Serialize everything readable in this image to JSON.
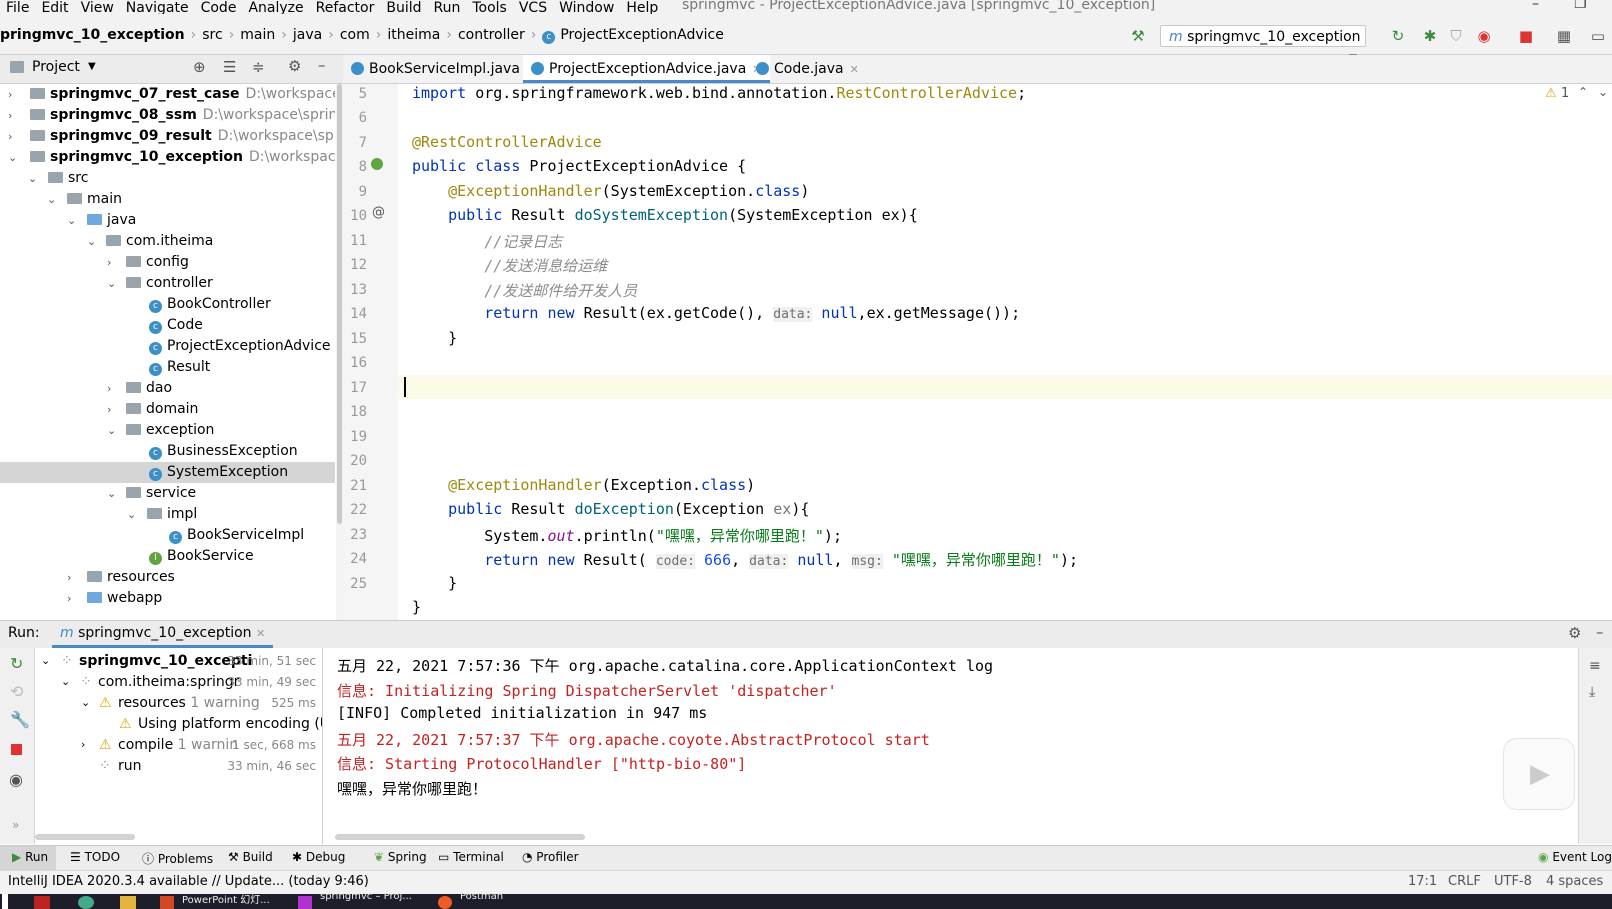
{
  "menubar": {
    "items": [
      "File",
      "Edit",
      "View",
      "Navigate",
      "Code",
      "Analyze",
      "Refactor",
      "Build",
      "Run",
      "Tools",
      "VCS",
      "Window",
      "Help"
    ],
    "window_title": "springmvc - ProjectExceptionAdvice.java [springmvc_10_exception]"
  },
  "breadcrumb": [
    "pringmvc_10_exception",
    "src",
    "main",
    "java",
    "com",
    "itheima",
    "controller",
    "ProjectExceptionAdvice"
  ],
  "run_config": "springmvc_10_exception",
  "project_panel": {
    "title": "Project"
  },
  "tree": [
    {
      "label": "springmvc_07_rest_case",
      "path": "D:\\workspace\\spri",
      "bold": true
    },
    {
      "label": "springmvc_08_ssm",
      "path": "D:\\workspace\\springmv",
      "bold": true
    },
    {
      "label": "springmvc_09_result",
      "path": "D:\\workspace\\springm",
      "bold": true
    },
    {
      "label": "springmvc_10_exception",
      "path": "D:\\workspace\\spr",
      "bold": true
    },
    {
      "label": "src"
    },
    {
      "label": "main"
    },
    {
      "label": "java"
    },
    {
      "label": "com.itheima"
    },
    {
      "label": "config"
    },
    {
      "label": "controller"
    },
    {
      "label": "BookController"
    },
    {
      "label": "Code"
    },
    {
      "label": "ProjectExceptionAdvice"
    },
    {
      "label": "Result"
    },
    {
      "label": "dao"
    },
    {
      "label": "domain"
    },
    {
      "label": "exception"
    },
    {
      "label": "BusinessException"
    },
    {
      "label": "SystemException"
    },
    {
      "label": "service"
    },
    {
      "label": "impl"
    },
    {
      "label": "BookServiceImpl"
    },
    {
      "label": "BookService"
    },
    {
      "label": "resources"
    },
    {
      "label": "webapp"
    }
  ],
  "tabs": [
    "BookServiceImpl.java",
    "ProjectExceptionAdvice.java",
    "Code.java"
  ],
  "editor": {
    "line_numbers": [
      "5",
      "6",
      "7",
      "8",
      "9",
      "10",
      "11",
      "12",
      "13",
      "14",
      "15",
      "16",
      "17",
      "18",
      "19",
      "20",
      "21",
      "22",
      "23",
      "24",
      "25"
    ],
    "code": {
      "l5_kw": "import ",
      "l5_pkg": "org.springframework.web.bind.annotation.",
      "l5_cls": "RestControllerAdvice",
      "l5_end": ";",
      "l7": "@RestControllerAdvice",
      "l8_kw": "public class ",
      "l8_name": "ProjectExceptionAdvice {",
      "l9_ann": "@ExceptionHandler",
      "l9_rest": "(SystemException.",
      "l9_cls": "class",
      "l9_end": ")",
      "l10_kw": "public ",
      "l10_type": "Result ",
      "l10_fn": "doSystemException",
      "l10_rest": "(SystemException ex){",
      "l11": "//记录日志",
      "l12": "//发送消息给运维",
      "l13": "//发送邮件给开发人员",
      "l14_kw": "return new ",
      "l14_a": "Result(ex.getCode(), ",
      "l14_hint": "data:",
      "l14_null": " null",
      "l14_b": ",ex.getMessage());",
      "l15": "}",
      "l21_ann": "@ExceptionHandler",
      "l21_rest": "(Exception.",
      "l21_cls": "class",
      "l21_end": ")",
      "l22_kw": "public ",
      "l22_type": "Result ",
      "l22_fn": "doException",
      "l22_rest": "(Exception ",
      "l22_ex": "ex",
      "l22_end": "){",
      "l23_a": "System.",
      "l23_out": "out",
      "l23_b": ".println(",
      "l23_str": "\"嘿嘿，异常你哪里跑！\"",
      "l23_end": ");",
      "l24_kw": "return new ",
      "l24_a": "Result( ",
      "l24_h1": "code:",
      "l24_num": " 666",
      "l24_c": ", ",
      "l24_h2": "data:",
      "l24_null": " null",
      "l24_d": ", ",
      "l24_h3": "msg:",
      "l24_str": " \"嘿嘿，异常你哪里跑！\"",
      "l24_end": ");",
      "l25": "}",
      "l26": "}"
    },
    "warning_count": "1"
  },
  "run_panel": {
    "label": "Run:",
    "tab": "springmvc_10_exception",
    "tree": [
      {
        "label": "springmvc_10_excepti",
        "time": "33 min, 51 sec"
      },
      {
        "label": "com.itheima:springr",
        "time": "33 min, 49 sec"
      },
      {
        "label": "resources",
        "note": "1 warning",
        "time": "525 ms"
      },
      {
        "label": "Using platform encoding (U",
        "time": ""
      },
      {
        "label": "compile",
        "note": "1 warnin",
        "time": "1 sec, 668 ms"
      },
      {
        "label": "run",
        "time": "33 min, 46 sec"
      }
    ],
    "console": [
      "五月 22, 2021 7:57:36 下午 org.apache.catalina.core.ApplicationContext log",
      "信息: Initializing Spring DispatcherServlet 'dispatcher'",
      "[INFO] Completed initialization in 947 ms",
      "五月 22, 2021 7:57:37 下午 org.apache.coyote.AbstractProtocol start",
      "信息: Starting ProtocolHandler [\"http-bio-80\"]",
      "嘿嘿，异常你哪里跑！"
    ]
  },
  "tool_windows": [
    "Run",
    "TODO",
    "Problems",
    "Build",
    "Debug",
    "Spring",
    "Terminal",
    "Profiler"
  ],
  "event_log": "Event Log",
  "status": {
    "message": "IntelliJ IDEA 2020.3.4 available // Update... (today 9:46)",
    "position": "17:1",
    "line_sep": "CRLF",
    "encoding": "UTF-8",
    "indent": "4 spaces"
  },
  "taskbar": [
    "PowerPoint 幻灯...",
    "springmvc – Proj...",
    "Postman"
  ],
  "colors": {
    "accent": "#4a88c7",
    "keyword": "#0033b3",
    "annotation": "#9e880d",
    "string": "#067d17"
  }
}
